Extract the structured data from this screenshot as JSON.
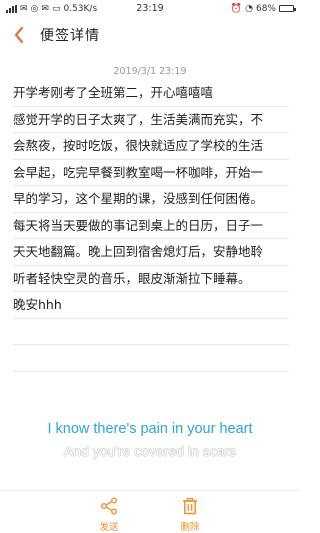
{
  "status_bar": {
    "carrier_text": "中国移动",
    "speed": "0.53K/s",
    "time": "23:19",
    "battery": "68%",
    "battery_level": 0.68
  },
  "header": {
    "title": "便签详情"
  },
  "note": {
    "timestamp": "2019/3/1 23:19",
    "lines": [
      "开学考刚考了全班第二，开心嘻嘻嘻",
      "感觉开学的日子太爽了，生活美满而充实，不",
      "会熬夜，按时吃饭，很快就适应了学校的生活",
      "会早起，吃完早餐到教室喝一杯咖啡，开始一",
      "早的学习，这个星期的课，没感到任何困倦。",
      "每天将当天要做的事记到桌上的日历，日子一",
      "天天地翻篇。晚上回到宿舍熄灯后，安静地聆",
      "听者轻快空灵的音乐，眼皮渐渐拉下睡幕。",
      "晚安hhh",
      "",
      ""
    ]
  },
  "lyrics": {
    "current": "I know there's pain in your heart",
    "next": "And you're covered in scars"
  },
  "actions": {
    "send_label": "发送",
    "delete_label": "删除"
  },
  "colors": {
    "accent": "#f0922e",
    "lyric_blue": "#2da6d3",
    "back_arrow": "#e0703a"
  }
}
